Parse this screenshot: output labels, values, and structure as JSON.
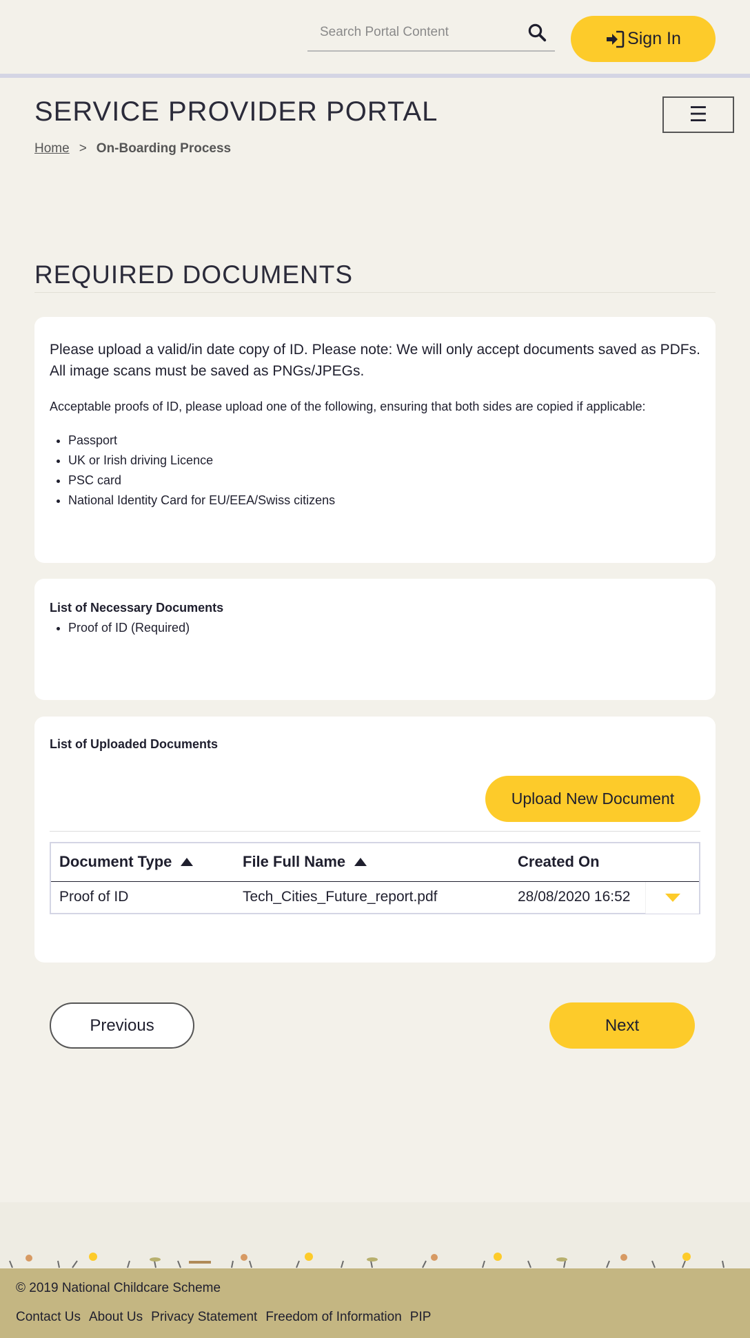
{
  "header": {
    "search_placeholder": "Search Portal Content",
    "signin_label": "Sign In",
    "portal_title": "SERVICE PROVIDER PORTAL",
    "menu_icon": "hamburger-icon"
  },
  "breadcrumb": {
    "home": "Home",
    "separator": ">",
    "current": "On-Boarding Process"
  },
  "main": {
    "section_title": "REQUIRED DOCUMENTS",
    "instructions": {
      "intro": "Please upload a valid/in date copy of ID. Please note: We will only accept documents saved as PDFs. All image scans must be saved as PNGs/JPEGs.",
      "accept_text": "Acceptable proofs of ID, please upload one of the following, ensuring that both sides are copied if applicable:",
      "id_types": [
        "Passport",
        "UK or Irish driving Licence",
        "PSC card",
        "National Identity Card for EU/EEA/Swiss citizens"
      ]
    },
    "necessary": {
      "heading": "List of Necessary Documents",
      "items": [
        "Proof of ID (Required)"
      ]
    },
    "uploaded": {
      "heading": "List of Uploaded Documents",
      "upload_label": "Upload New Document",
      "columns": [
        "Document Type",
        "File Full Name",
        "Created On"
      ],
      "rows": [
        {
          "type": "Proof of ID",
          "file": "Tech_Cities_Future_report.pdf",
          "created": "28/08/2020 16:52"
        }
      ]
    }
  },
  "nav": {
    "previous_label": "Previous",
    "next_label": "Next"
  },
  "footer": {
    "copyright": "© 2019 National Childcare Scheme",
    "links": [
      "Contact Us",
      "About Us",
      "Privacy Statement",
      "Freedom of Information",
      "PIP"
    ]
  },
  "colors": {
    "accent": "#fdcb2a",
    "background": "#f3f1ea",
    "footer": "#c4b682",
    "text": "#1f1f2e"
  }
}
